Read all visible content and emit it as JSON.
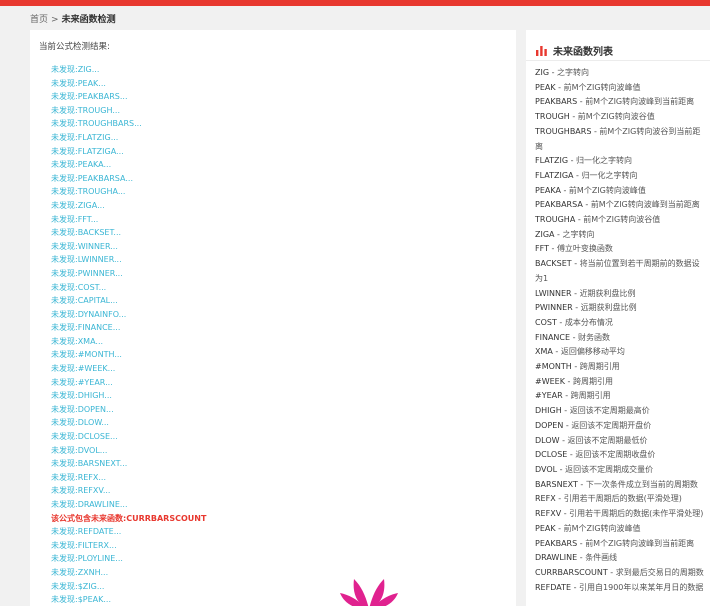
{
  "breadcrumb": {
    "home": "首页",
    "separator": ">",
    "current": "未来函数检测"
  },
  "left": {
    "result_title": "当前公式检测结果:",
    "items": [
      {
        "text": "未发现:ZIG...",
        "hit": false
      },
      {
        "text": "未发现:PEAK...",
        "hit": false
      },
      {
        "text": "未发现:PEAKBARS...",
        "hit": false
      },
      {
        "text": "未发现:TROUGH...",
        "hit": false
      },
      {
        "text": "未发现:TROUGHBARS...",
        "hit": false
      },
      {
        "text": "未发现:FLATZIG...",
        "hit": false
      },
      {
        "text": "未发现:FLATZIGA...",
        "hit": false
      },
      {
        "text": "未发现:PEAKA...",
        "hit": false
      },
      {
        "text": "未发现:PEAKBARSA...",
        "hit": false
      },
      {
        "text": "未发现:TROUGHA...",
        "hit": false
      },
      {
        "text": "未发现:ZIGA...",
        "hit": false
      },
      {
        "text": "未发现:FFT...",
        "hit": false
      },
      {
        "text": "未发现:BACKSET...",
        "hit": false
      },
      {
        "text": "未发现:WINNER...",
        "hit": false
      },
      {
        "text": "未发现:LWINNER...",
        "hit": false
      },
      {
        "text": "未发现:PWINNER...",
        "hit": false
      },
      {
        "text": "未发现:COST...",
        "hit": false
      },
      {
        "text": "未发现:CAPITAL...",
        "hit": false
      },
      {
        "text": "未发现:DYNAINFO...",
        "hit": false
      },
      {
        "text": "未发现:FINANCE...",
        "hit": false
      },
      {
        "text": "未发现:XMA...",
        "hit": false
      },
      {
        "text": "未发现:#MONTH...",
        "hit": false
      },
      {
        "text": "未发现:#WEEK...",
        "hit": false
      },
      {
        "text": "未发现:#YEAR...",
        "hit": false
      },
      {
        "text": "未发现:DHIGH...",
        "hit": false
      },
      {
        "text": "未发现:DOPEN...",
        "hit": false
      },
      {
        "text": "未发现:DLOW...",
        "hit": false
      },
      {
        "text": "未发现:DCLOSE...",
        "hit": false
      },
      {
        "text": "未发现:DVOL...",
        "hit": false
      },
      {
        "text": "未发现:BARSNEXT...",
        "hit": false
      },
      {
        "text": "未发现:REFX...",
        "hit": false
      },
      {
        "text": "未发现:REFXV...",
        "hit": false
      },
      {
        "text": "未发现:DRAWLINE...",
        "hit": false
      },
      {
        "text": "该公式包含未来函数:CURRBARSCOUNT",
        "hit": true
      },
      {
        "text": "未发现:REFDATE...",
        "hit": false
      },
      {
        "text": "未发现:FILTERX...",
        "hit": false
      },
      {
        "text": "未发现:PLOYLINE...",
        "hit": false
      },
      {
        "text": "未发现:ZXNH...",
        "hit": false
      },
      {
        "text": "未发现:$ZIG...",
        "hit": false
      },
      {
        "text": "未发现:$PEAK...",
        "hit": false
      }
    ]
  },
  "right": {
    "title": "未来函数列表",
    "functions": [
      {
        "name": "ZIG",
        "desc": "之字转向"
      },
      {
        "name": "PEAK",
        "desc": "前M个ZIG转向波峰值"
      },
      {
        "name": "PEAKBARS",
        "desc": "前M个ZIG转向波峰到当前距离"
      },
      {
        "name": "TROUGH",
        "desc": "前M个ZIG转向波谷值"
      },
      {
        "name": "TROUGHBARS",
        "desc": "前M个ZIG转向波谷到当前距离"
      },
      {
        "name": "FLATZIG",
        "desc": "归一化之字转向"
      },
      {
        "name": "FLATZIGA",
        "desc": "归一化之字转向"
      },
      {
        "name": "PEAKA",
        "desc": "前M个ZIG转向波峰值"
      },
      {
        "name": "PEAKBARSA",
        "desc": "前M个ZIG转向波峰到当前距离"
      },
      {
        "name": "TROUGHA",
        "desc": "前M个ZIG转向波谷值"
      },
      {
        "name": "ZIGA",
        "desc": "之字转向"
      },
      {
        "name": "FFT",
        "desc": "傅立叶变换函数"
      },
      {
        "name": "BACKSET",
        "desc": "将当前位置到若干周期前的数据设为1"
      },
      {
        "name": "LWINNER",
        "desc": "近期获利盘比例"
      },
      {
        "name": "PWINNER",
        "desc": "远期获利盘比例"
      },
      {
        "name": "COST",
        "desc": "成本分布情况"
      },
      {
        "name": "FINANCE",
        "desc": "财务函数"
      },
      {
        "name": "XMA",
        "desc": "返回偏移移动平均"
      },
      {
        "name": "#MONTH",
        "desc": "跨周期引用"
      },
      {
        "name": "#WEEK",
        "desc": "跨周期引用"
      },
      {
        "name": "#YEAR",
        "desc": "跨周期引用"
      },
      {
        "name": "DHIGH",
        "desc": "返回该不定周期最高价"
      },
      {
        "name": "DOPEN",
        "desc": "返回该不定周期开盘价"
      },
      {
        "name": "DLOW",
        "desc": "返回该不定周期最低价"
      },
      {
        "name": "DCLOSE",
        "desc": "返回该不定周期收盘价"
      },
      {
        "name": "DVOL",
        "desc": "返回该不定周期成交量价"
      },
      {
        "name": "BARSNEXT",
        "desc": "下一次条件成立到当前的周期数"
      },
      {
        "name": "REFX",
        "desc": "引用若干周期后的数据(平滑处理)"
      },
      {
        "name": "REFXV",
        "desc": "引用若干周期后的数据(未作平滑处理)"
      },
      {
        "name": "PEAK",
        "desc": "前M个ZIG转向波峰值"
      },
      {
        "name": "PEAKBARS",
        "desc": "前M个ZIG转向波峰到当前距离"
      },
      {
        "name": "DRAWLINE",
        "desc": "条件画线"
      },
      {
        "name": "CURRBARSCOUNT",
        "desc": "求到最后交易日的周期数"
      },
      {
        "name": "REFDATE",
        "desc": "引用自1900年以来某年月日的数据"
      }
    ]
  },
  "colors": {
    "accent": "#e8382f",
    "link": "#3ab6d4",
    "hit": "#e8382f",
    "logo": "#e0228f"
  }
}
